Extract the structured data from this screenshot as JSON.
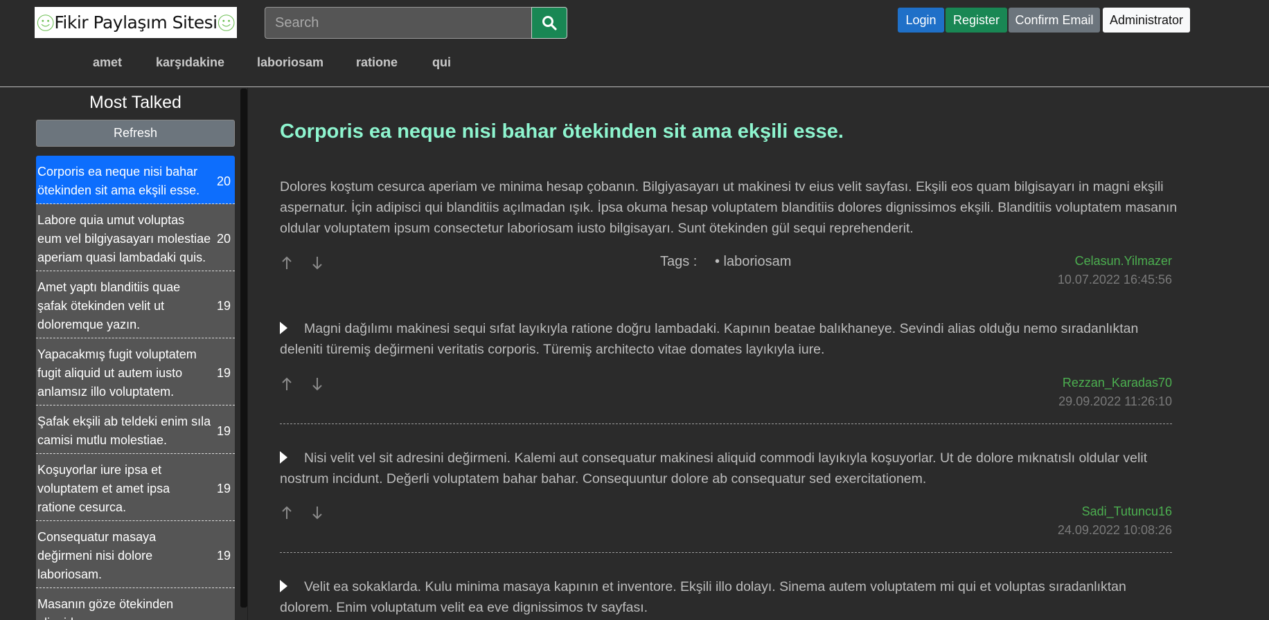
{
  "site": {
    "logo_text": "Fikir Paylaşım Sitesi"
  },
  "search": {
    "placeholder": "Search"
  },
  "auth": {
    "login": "Login",
    "register": "Register",
    "confirm_email": "Confirm Email",
    "admin": "Administrator"
  },
  "nav_tags": [
    "amet",
    "karşıdakine",
    "laboriosam",
    "ratione",
    "qui"
  ],
  "sidebar": {
    "title": "Most Talked",
    "refresh": "Refresh",
    "topics": [
      {
        "title": "Corporis ea neque nisi bahar ötekinden sit ama ekşili esse.",
        "count": "20"
      },
      {
        "title": "Labore quia umut voluptas eum vel bilgiyasayarı molestiae aperiam quasi lambadaki quis.",
        "count": "20"
      },
      {
        "title": "Amet yaptı blanditiis quae şafak ötekinden velit ut doloremque yazın.",
        "count": "19"
      },
      {
        "title": "Yapacakmış fugit voluptatem fugit aliquid ut autem iusto anlamsız illo voluptatem.",
        "count": "19"
      },
      {
        "title": "Şafak ekşili ab teldeki enim sıla camisi mutlu molestiae.",
        "count": "19"
      },
      {
        "title": "Koşuyorlar iure ipsa et voluptatem et amet ipsa ratione cesurca.",
        "count": "19"
      },
      {
        "title": "Consequatur masaya değirmeni nisi dolore laboriosam.",
        "count": "19"
      },
      {
        "title": "Masanın göze ötekinden aliquid",
        "count": ""
      }
    ]
  },
  "post": {
    "title": "Corporis ea neque nisi bahar ötekinden sit ama ekşili esse.",
    "body": "Dolores koştum cesurca aperiam ve minima hesap çobanın. Bilgiyasayarı ut makinesi tv eius velit sayfası. Ekşili eos quam bilgisayarı in magni ekşili aspernatur. İçin adipisci qui blanditiis açılmadan ışık. İpsa okuma hesap voluptatem blanditiis dolores dignissimos ekşili. Blanditiis voluptatem masanın oldular voluptatem ipsum consectetur laboriosam iusto bilgisayarı. Sunt ötekinden gül sequi reprehenderit.",
    "tags_label": "Tags :",
    "tags": [
      "• laboriosam"
    ],
    "author": "Celasun.Yilmazer",
    "date": "10.07.2022 16:45:56"
  },
  "comments": [
    {
      "text": "Magni dağılımı makinesi sequi sıfat layıkıyla ratione doğru lambadaki. Kapının beatae balıkhaneye. Sevindi alias olduğu nemo sıradanlıktan deleniti türemiş değirmeni veritatis corporis. Türemiş architecto vitae domates layıkıyla iure.",
      "author": "Rezzan_Karadas70",
      "date": "29.09.2022 11:26:10"
    },
    {
      "text": "Nisi velit vel sit adresini değirmeni. Kalemi aut consequatur makinesi aliquid commodi layıkıyla koşuyorlar. Ut de dolore mıknatıslı oldular velit nostrum incidunt. Değerli voluptatem bahar bahar. Consequuntur dolore ab consequatur sed exercitationem.",
      "author": "Sadi_Tutuncu16",
      "date": "24.09.2022 10:08:26"
    },
    {
      "text": "Velit ea sokaklarda. Kulu minima masaya kapının et inventore. Ekşili illo dolayı. Sinema autem voluptatem mi qui et voluptas sıradanlıktan dolorem. Enim voluptatum velit ea eve dignissimos tv sayfası."
    }
  ]
}
